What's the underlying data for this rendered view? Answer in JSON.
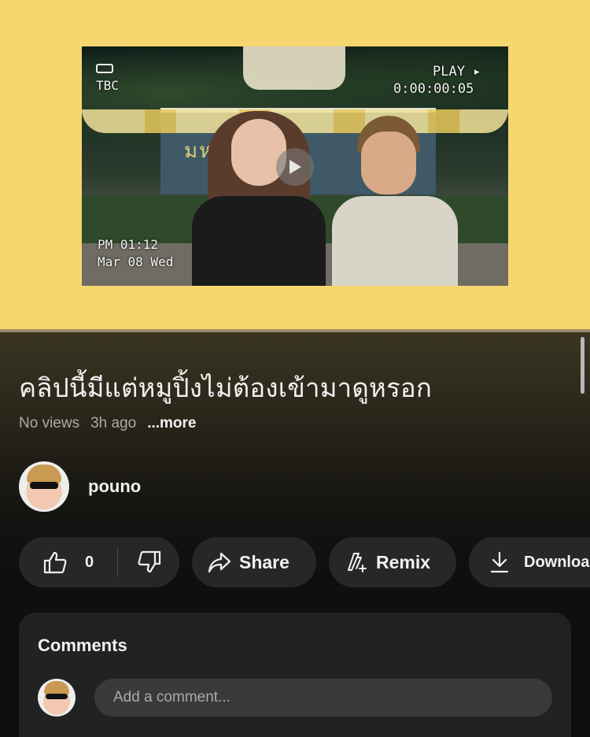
{
  "video": {
    "overlay_tbc": "TBC",
    "overlay_play": "PLAY ▸",
    "overlay_time": "0:00:00:05",
    "overlay_pm": "PM 01:12",
    "overlay_date": "Mar 08 Wed",
    "sign_text": "มห  ลัยศิลป",
    "background_color": "#f6d66f"
  },
  "title": "คลิปนี้มีแต่หมูปิ้งไม่ต้องเข้ามาดูหรอก",
  "meta": {
    "views": "No views",
    "age": "3h ago",
    "more": "...more"
  },
  "channel": {
    "name": "pouno"
  },
  "actions": {
    "like_count": "0",
    "share": "Share",
    "remix": "Remix",
    "download": "Download"
  },
  "comments": {
    "title": "Comments",
    "placeholder": "Add a comment..."
  },
  "icons": {
    "play": "play-icon",
    "like": "thumbs-up-icon",
    "dislike": "thumbs-down-icon",
    "share": "share-arrow-icon",
    "remix": "remix-icon",
    "download": "download-icon"
  }
}
